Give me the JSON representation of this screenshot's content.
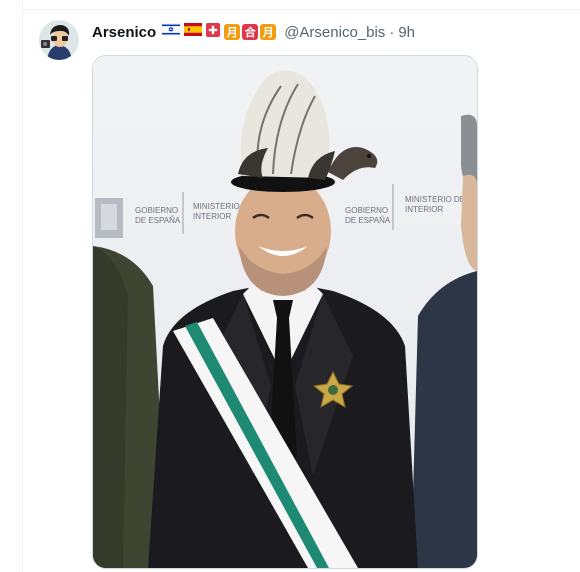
{
  "tweet": {
    "display_name": "Arsenico",
    "handle": "@Arsenico_bis",
    "separator": "·",
    "time": "9h",
    "emoji": [
      "israel-flag",
      "spain-flag",
      "swiss-flag",
      "moon-kanji",
      "combine-kanji",
      "moon-kanji"
    ],
    "kanji": {
      "moon": "月",
      "combine": "合"
    },
    "photo_text": {
      "left_line1": "GOBIERNO",
      "left_line2": "DE ESPAÑA",
      "mid_line1": "MINISTERIO",
      "mid_line2": "INTERIOR",
      "right_line1": "GOBIERNO",
      "right_line2": "DE ESPAÑA",
      "far_line1": "MINISTERIO DEL",
      "far_line2": "INTERIOR"
    }
  },
  "colors": {
    "text_primary": "#0f1419",
    "text_secondary": "#536471",
    "border": "#cfd9de",
    "kanji_orange": "#f39c12",
    "kanji_red": "#e0384b"
  }
}
